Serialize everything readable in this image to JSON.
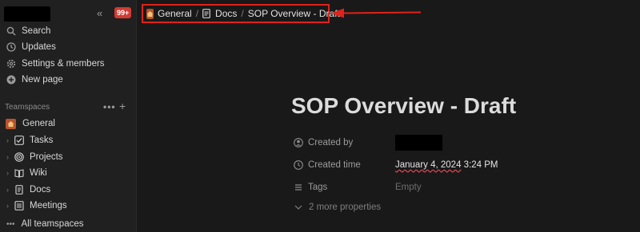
{
  "sidebar": {
    "notification_count": "99+",
    "nav": [
      {
        "label": "Search",
        "icon": "search-icon"
      },
      {
        "label": "Updates",
        "icon": "clock-icon"
      },
      {
        "label": "Settings & members",
        "icon": "gear-icon"
      },
      {
        "label": "New page",
        "icon": "plus-circle-icon"
      }
    ],
    "teamspaces_header": "Teamspaces",
    "teamspace_more": "•••",
    "teamspace_add": "+",
    "teamspaces": [
      {
        "label": "General",
        "icon": "home-icon"
      },
      {
        "label": "Tasks",
        "icon": "checkbox-icon"
      },
      {
        "label": "Projects",
        "icon": "target-icon"
      },
      {
        "label": "Wiki",
        "icon": "book-icon"
      },
      {
        "label": "Docs",
        "icon": "document-icon"
      },
      {
        "label": "Meetings",
        "icon": "list-icon"
      }
    ],
    "all_teamspaces": "All teamspaces"
  },
  "breadcrumb": {
    "items": [
      "General",
      "Docs",
      "SOP Overview - Draft"
    ],
    "separator": "/"
  },
  "page": {
    "title": "SOP Overview - Draft",
    "properties": [
      {
        "label": "Created by",
        "value": ""
      },
      {
        "label": "Created time",
        "value_date": "January 4, 2024",
        "value_time": " 3:24 PM"
      },
      {
        "label": "Tags",
        "value": "Empty"
      }
    ],
    "more_properties": "2 more properties"
  },
  "colors": {
    "highlight_box": "#e0221a",
    "annotation_arrow": "#e0221a",
    "home_icon_bg": "#b5532a",
    "badge": "#d23b33"
  }
}
